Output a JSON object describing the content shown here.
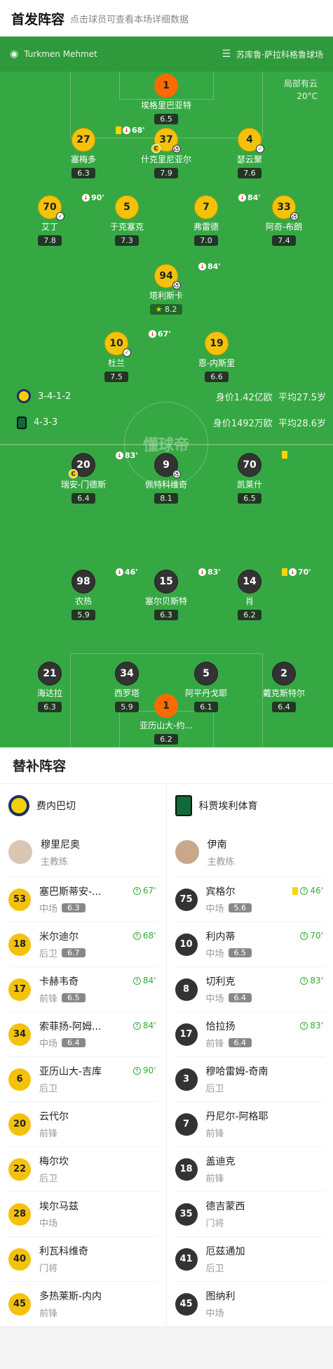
{
  "header": {
    "title": "首发阵容",
    "subtitle": "点击球员可查看本场详细数据"
  },
  "match": {
    "referee": "Turkmen Mehmet",
    "stadium": "苏库鲁·萨拉科格鲁球场",
    "weather": "局部有云",
    "temperature": "20°C"
  },
  "home": {
    "formation": "3-4-1-2",
    "value": "身价1.42亿欧",
    "age": "平均27.5岁"
  },
  "away": {
    "formation": "4-3-3",
    "value": "身价1492万欧",
    "age": "平均28.6岁"
  },
  "watermark": "懂球帝",
  "home_players": [
    {
      "num": "1",
      "name": "埃格里巴亚特",
      "rating": "6.5"
    },
    {
      "num": "27",
      "name": "塞梅多",
      "rating": "6.3",
      "ev": "68'"
    },
    {
      "num": "37",
      "name": "什克里尼亚尔",
      "rating": "7.9"
    },
    {
      "num": "4",
      "name": "瑟云聚",
      "rating": "7.6"
    },
    {
      "num": "70",
      "name": "艾丁",
      "rating": "7.8",
      "ev": "90'"
    },
    {
      "num": "5",
      "name": "于克塞克",
      "rating": "7.3"
    },
    {
      "num": "7",
      "name": "弗雷德",
      "rating": "7.0",
      "ev": "84'"
    },
    {
      "num": "33",
      "name": "阿奇-布朗",
      "rating": "7.4"
    },
    {
      "num": "94",
      "name": "塔利斯卡",
      "rating": "8.2",
      "ev": "84'"
    },
    {
      "num": "10",
      "name": "杜兰",
      "rating": "7.5",
      "ev": "67'"
    },
    {
      "num": "19",
      "name": "恩-内斯里",
      "rating": "6.6"
    }
  ],
  "away_players": [
    {
      "num": "20",
      "name": "瑞安-门德斯",
      "rating": "6.4",
      "ev": "83'"
    },
    {
      "num": "9",
      "name": "佩特科维奇",
      "rating": "8.1"
    },
    {
      "num": "70",
      "name": "凯莱什",
      "rating": "6.5"
    },
    {
      "num": "98",
      "name": "农热",
      "rating": "5.9",
      "ev": "46'"
    },
    {
      "num": "15",
      "name": "塞尔贝斯特",
      "rating": "6.3",
      "ev": "83'"
    },
    {
      "num": "14",
      "name": "肖",
      "rating": "6.2",
      "ev": "70'"
    },
    {
      "num": "21",
      "name": "海达拉",
      "rating": "6.3"
    },
    {
      "num": "34",
      "name": "西罗塔",
      "rating": "5.9"
    },
    {
      "num": "5",
      "name": "阿平丹戈耶",
      "rating": "6.1"
    },
    {
      "num": "2",
      "name": "戴克斯特尔",
      "rating": "6.4"
    },
    {
      "num": "1",
      "name": "亚历山大-约...",
      "rating": "6.2"
    }
  ],
  "bench": {
    "title": "替补阵容",
    "home_team": "费内巴切",
    "away_team": "科贾埃利体育",
    "home_coach": "穆里尼奥",
    "away_coach": "伊南",
    "coach_role": "主教练",
    "home_subs": [
      {
        "num": "53",
        "name": "塞巴斯蒂安-...",
        "pos": "中场",
        "rating": "6.3",
        "in": "67'"
      },
      {
        "num": "18",
        "name": "米尔迪尔",
        "pos": "后卫",
        "rating": "6.7",
        "in": "68'"
      },
      {
        "num": "17",
        "name": "卡赫韦奇",
        "pos": "前锋",
        "rating": "6.5",
        "in": "84'"
      },
      {
        "num": "34",
        "name": "索菲扬-阿姆...",
        "pos": "中场",
        "rating": "6.4",
        "in": "84'"
      },
      {
        "num": "6",
        "name": "亚历山大-吉库",
        "pos": "后卫",
        "in": "90'"
      },
      {
        "num": "20",
        "name": "云代尔",
        "pos": "前锋"
      },
      {
        "num": "22",
        "name": "梅尔坎",
        "pos": "后卫"
      },
      {
        "num": "28",
        "name": "埃尔马兹",
        "pos": "中场"
      },
      {
        "num": "40",
        "name": "利瓦科维奇",
        "pos": "门将"
      },
      {
        "num": "45",
        "name": "多热莱斯-内内",
        "pos": "前锋"
      }
    ],
    "away_subs": [
      {
        "num": "75",
        "name": "宾格尔",
        "pos": "中场",
        "rating": "5.6",
        "in": "46'"
      },
      {
        "num": "10",
        "name": "利内蒂",
        "pos": "中场",
        "rating": "6.5",
        "in": "70'"
      },
      {
        "num": "8",
        "name": "切利克",
        "pos": "中场",
        "rating": "6.4",
        "in": "83'"
      },
      {
        "num": "17",
        "name": "恰拉扬",
        "pos": "前锋",
        "rating": "6.4",
        "in": "83'"
      },
      {
        "num": "3",
        "name": "穆哈雷姆-奇南",
        "pos": "后卫"
      },
      {
        "num": "7",
        "name": "丹尼尔-阿格耶",
        "pos": "前锋"
      },
      {
        "num": "18",
        "name": "盖迪克",
        "pos": "前锋"
      },
      {
        "num": "35",
        "name": "德吉蒙西",
        "pos": "门将"
      },
      {
        "num": "41",
        "name": "厄兹通加",
        "pos": "后卫"
      },
      {
        "num": "45",
        "name": "图纳利",
        "pos": "中场"
      }
    ]
  }
}
